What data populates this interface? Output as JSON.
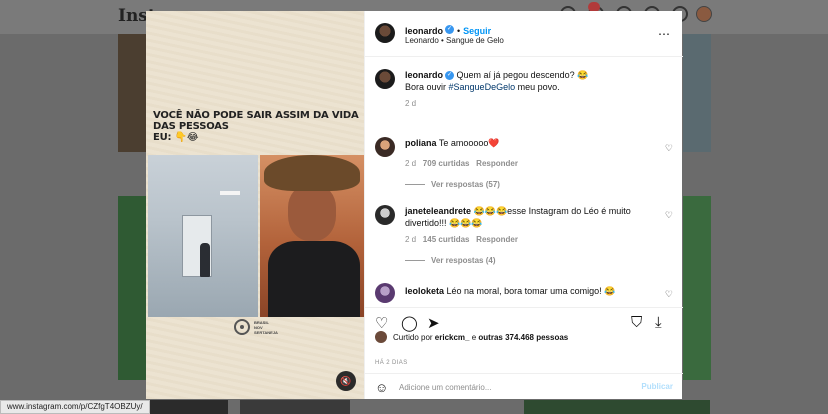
{
  "background": {
    "logo": "Insta",
    "status_url": "www.instagram.com/p/CZfgT4OBZUy/"
  },
  "post": {
    "media": {
      "meme_line1": "VOCÊ NÃO PODE SAIR ASSIM DA VIDA DAS PESSOAS",
      "meme_line2": "EU: 👇😂",
      "watermark_line1": "BRASIL NOV",
      "watermark_line2": "SERTANEJA"
    },
    "header": {
      "username": "leonardo",
      "follow_label": "Seguir",
      "subtitle": "Leonardo • Sangue de Gelo",
      "more_icon": "⋯"
    },
    "caption": {
      "username": "leonardo",
      "text": "Quem aí já pegou descendo? 😂",
      "text2_prefix": "Bora ouvir ",
      "hashtag": "#SangueDeGelo",
      "text2_suffix": " meu povo.",
      "time": "2 d"
    },
    "comments": [
      {
        "username": "poliana",
        "text": "Te amooooo❤️",
        "time": "2 d",
        "likes": "709 curtidas",
        "reply": "Responder",
        "replies": "Ver respostas (57)"
      },
      {
        "username": "janeteleandrete",
        "text": "😂😂😂esse Instagram do Léo é muito divertido!!! 😂😂😂",
        "time": "2 d",
        "likes": "145 curtidas",
        "reply": "Responder",
        "replies": "Ver respostas (4)"
      },
      {
        "username": "leoloketa",
        "text": "Léo na moral, bora tomar uma comigo! 😂"
      }
    ],
    "likes": {
      "prefix": "Curtido por ",
      "user": "erickcm_",
      "middle": " e ",
      "others": "outras 374.468 pessoas"
    },
    "posted_ago": "HÁ 2 DIAS",
    "comment_box": {
      "placeholder": "Adicione um comentário...",
      "publish_label": "Publicar"
    }
  }
}
